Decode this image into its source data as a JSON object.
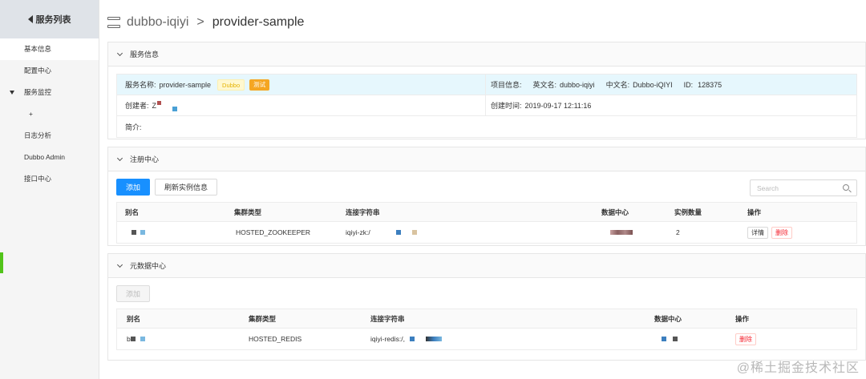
{
  "sidebar": {
    "title": "服务列表",
    "items": [
      {
        "label": "基本信息"
      },
      {
        "label": "配置中心"
      },
      {
        "label": "服务监控"
      },
      {
        "label": "+"
      },
      {
        "label": "日志分析"
      },
      {
        "label": "Dubbo Admin"
      },
      {
        "label": "接口中心"
      }
    ]
  },
  "breadcrumb": {
    "app": "dubbo-iqiyi",
    "separator": ">",
    "service": "provider-sample"
  },
  "service_info": {
    "title": "服务信息",
    "service_name_label": "服务名称:",
    "service_name": "provider-sample",
    "tag_dubbo": "Dubbo",
    "tag_test": "测试",
    "project_label": "项目信息:",
    "en_name_label": "英文名:",
    "en_name": "dubbo-iqiyi",
    "cn_name_label": "中文名:",
    "cn_name": "Dubbo-iQIYI",
    "id_label": "ID:",
    "id": "128375",
    "creator_label": "创建者:",
    "creator": "Z",
    "created_label": "创建时间:",
    "created": "2019-09-17 12:11:16",
    "intro_label": "简介:"
  },
  "registry": {
    "title": "注册中心",
    "add_label": "添加",
    "refresh_label": "刷新实例信息",
    "search_placeholder": "Search",
    "columns": [
      "别名",
      "集群类型",
      "连接字符串",
      "数据中心",
      "实例数量",
      "操作"
    ],
    "rows": [
      {
        "cluster": "HOSTED_ZOOKEEPER",
        "conn": "iqiyi-zk:/",
        "count": "2",
        "detail": "详情",
        "delete": "删除"
      }
    ]
  },
  "metadata": {
    "title": "元数据中心",
    "add_label": "添加",
    "columns": [
      "别名",
      "集群类型",
      "连接字符串",
      "数据中心",
      "操作"
    ],
    "rows": [
      {
        "alias": "b",
        "cluster": "HOSTED_REDIS",
        "conn": "iqiyi-redis:/,",
        "delete": "删除"
      }
    ]
  },
  "watermark": "@稀土掘金技术社区",
  "colors": {
    "primary": "#1890ff",
    "highlight_row": "#e6f7fd",
    "tag_test": "#f5a623",
    "danger": "#f5222d"
  }
}
